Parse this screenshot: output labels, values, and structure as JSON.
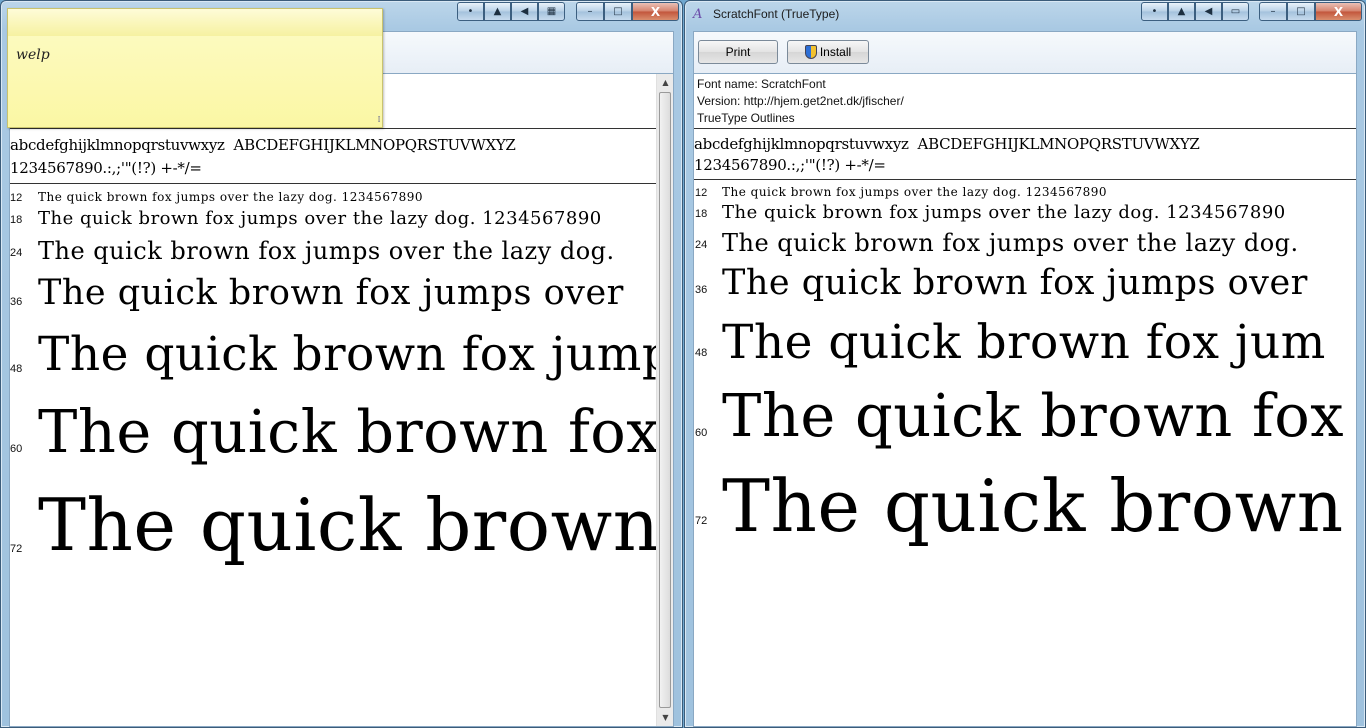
{
  "left_window": {
    "controls": {
      "pin": "•",
      "up": "▲",
      "left": "◀",
      "box": "▦",
      "minimize": "–",
      "maximize": "□",
      "close": "X"
    },
    "charset": {
      "lower": "abcdefghijklmnopqrstuvwxyz",
      "upper": "ABCDEFGHIJKLMNOPQRSTUVWXYZ",
      "digits": "1234567890.:,;'\"(!?) +-*/="
    },
    "samples": [
      {
        "size": "12",
        "text": "The quick brown fox jumps over the lazy dog. 1234567890"
      },
      {
        "size": "18",
        "text": "The quick brown fox jumps over the lazy dog. 1234567890"
      },
      {
        "size": "24",
        "text": "The quick brown fox jumps over the lazy dog."
      },
      {
        "size": "36",
        "text": "The quick brown fox jumps over"
      },
      {
        "size": "48",
        "text": "The quick brown fox jumps"
      },
      {
        "size": "60",
        "text": "The quick brown fox"
      },
      {
        "size": "72",
        "text": "The quick brown"
      }
    ]
  },
  "sticky_note": {
    "text": "welp",
    "grip": "⁞⁞"
  },
  "right_window": {
    "title": "ScratchFont (TrueType)",
    "title_icon": "A",
    "controls": {
      "pin": "•",
      "up": "▲",
      "left": "◀",
      "box": "▭",
      "minimize": "–",
      "maximize": "□",
      "close": "X"
    },
    "toolbar": {
      "print_label": "Print",
      "install_label": "Install"
    },
    "meta": {
      "font_name": "Font name: ScratchFont",
      "version": "Version: http://hjem.get2net.dk/jfischer/",
      "outlines": "TrueType Outlines"
    },
    "charset": {
      "lower": "abcdefghijklmnopqrstuvwxyz",
      "upper": "ABCDEFGHIJKLMNOPQRSTUVWXYZ",
      "digits": "1234567890.:,;'\"(!?) +-*/="
    },
    "samples": [
      {
        "size": "12",
        "text": "The quick brown fox jumps over the lazy dog. 1234567890"
      },
      {
        "size": "18",
        "text": "The quick brown fox jumps over the lazy dog. 1234567890"
      },
      {
        "size": "24",
        "text": "The quick brown fox jumps over the lazy dog."
      },
      {
        "size": "36",
        "text": "The quick brown fox jumps over"
      },
      {
        "size": "48",
        "text": "The quick brown fox jum"
      },
      {
        "size": "60",
        "text": "The quick brown fox"
      },
      {
        "size": "72",
        "text": "The quick brown"
      }
    ]
  },
  "scrollbar": {
    "up": "▲",
    "down": "▼"
  }
}
